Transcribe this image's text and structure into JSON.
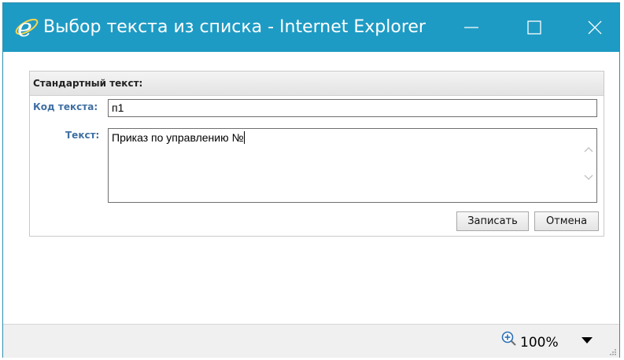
{
  "window": {
    "title": "Выбор текста из списка - Internet Explorer",
    "titlebar_color": "#1e9bc4",
    "icon": "internet-explorer-icon"
  },
  "panel": {
    "header": "Стандартный текст:",
    "code_label": "Код текста:",
    "code_value": "п1",
    "text_label": "Текст:",
    "text_value": "Приказ по управлению №"
  },
  "buttons": {
    "save": "Записать",
    "cancel": "Отмена"
  },
  "statusbar": {
    "zoom": "100%",
    "zoom_icon": "zoom-in-icon"
  }
}
